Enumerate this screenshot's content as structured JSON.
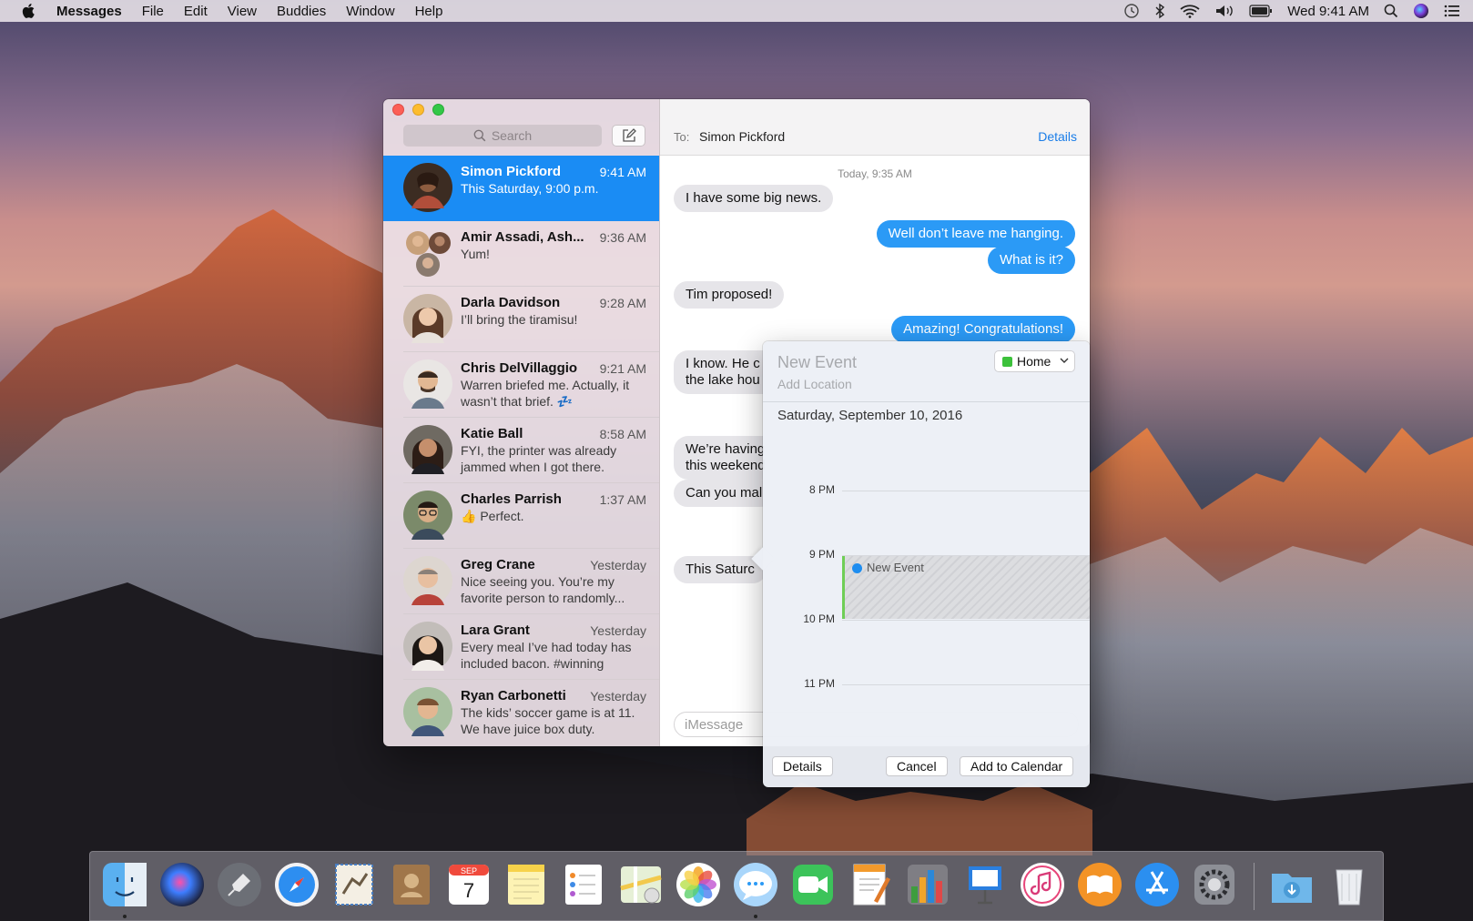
{
  "menubar": {
    "app_name": "Messages",
    "menus": [
      "File",
      "Edit",
      "View",
      "Buddies",
      "Window",
      "Help"
    ],
    "clock": "Wed 9:41 AM",
    "status_icons": [
      "time-machine-icon",
      "bluetooth-icon",
      "wifi-icon",
      "volume-icon",
      "battery-icon",
      "spotlight-icon",
      "siri-icon",
      "notification-center-icon"
    ]
  },
  "sidebar": {
    "search_placeholder": "Search",
    "conversations": [
      {
        "name": "Simon Pickford",
        "time": "9:41 AM",
        "preview": "This Saturday, 9:00 p.m.",
        "selected": true
      },
      {
        "name": "Amir Assadi, Ash...",
        "time": "9:36 AM",
        "preview": "Yum!"
      },
      {
        "name": "Darla Davidson",
        "time": "9:28 AM",
        "preview": "I’ll bring the tiramisu!"
      },
      {
        "name": "Chris DelVillaggio",
        "time": "9:21 AM",
        "preview": "Warren briefed me. Actually, it wasn’t that brief. 💤"
      },
      {
        "name": "Katie Ball",
        "time": "8:58 AM",
        "preview": "FYI, the printer was already jammed when I got there."
      },
      {
        "name": "Charles Parrish",
        "time": "1:37 AM",
        "preview": "👍 Perfect."
      },
      {
        "name": "Greg Crane",
        "time": "Yesterday",
        "preview": "Nice seeing you. You’re my favorite person to randomly..."
      },
      {
        "name": "Lara Grant",
        "time": "Yesterday",
        "preview": "Every meal I’ve had today has included bacon. #winning"
      },
      {
        "name": "Ryan Carbonetti",
        "time": "Yesterday",
        "preview": "The kids’ soccer game is at 11. We have juice box duty."
      }
    ]
  },
  "chat": {
    "to_label": "To:",
    "to_name": "Simon Pickford",
    "details_label": "Details",
    "timestamp": "Today, 9:35 AM",
    "messages": [
      {
        "text": "I have some big news.",
        "dir": "in"
      },
      {
        "text": "Well don’t leave me hanging.",
        "dir": "out"
      },
      {
        "text": "What is it?",
        "dir": "out"
      },
      {
        "text": "Tim proposed!",
        "dir": "in"
      },
      {
        "text": "Amazing! Congratulations!",
        "dir": "out"
      },
      {
        "text": "I know. He c the lake hou",
        "dir": "in"
      },
      {
        "text": "We’re having this weekend",
        "dir": "in"
      },
      {
        "text": "Can you mal",
        "dir": "in"
      },
      {
        "text": "This Saturc",
        "dir": "in"
      }
    ],
    "input_placeholder": "iMessage"
  },
  "event_popover": {
    "title_placeholder": "New Event",
    "location_placeholder": "Add Location",
    "calendar": "Home",
    "date": "Saturday, September 10, 2016",
    "hours": [
      "8 PM",
      "9 PM",
      "10 PM",
      "11 PM"
    ],
    "event_title": "New Event",
    "buttons": {
      "details": "Details",
      "cancel": "Cancel",
      "add": "Add to Calendar"
    },
    "colors": {
      "calendar": "#3cc13b",
      "event_dot": "#1e8df0"
    }
  },
  "dock": {
    "apps": [
      "Finder",
      "Siri",
      "Launchpad",
      "Safari",
      "Mail",
      "Contacts",
      "Calendar",
      "Notes",
      "Reminders",
      "Maps",
      "Photos",
      "Messages",
      "FaceTime",
      "Pages",
      "Numbers",
      "Keynote",
      "iTunes",
      "iBooks",
      "App Store",
      "System Preferences",
      "Downloads",
      "Trash"
    ],
    "calendar_month": "SEP",
    "calendar_day": "7"
  },
  "colors": {
    "accent": "#1a8cf4",
    "bubble_out": "#2b9af6",
    "bubble_in": "#e6e5e9"
  }
}
